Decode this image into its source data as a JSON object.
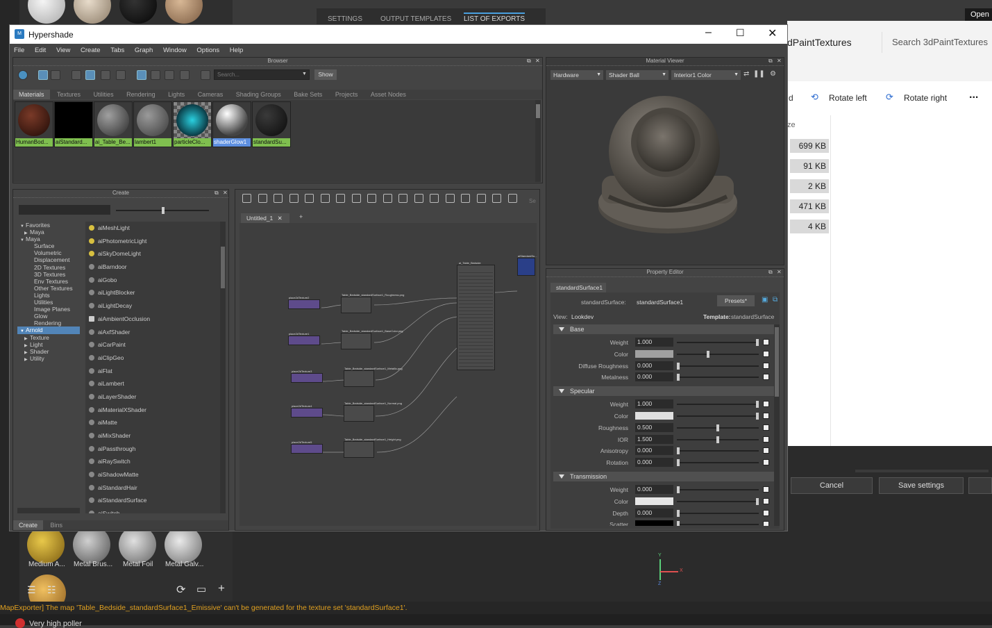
{
  "hypershade": {
    "title": "Hypershade",
    "menu": [
      "File",
      "Edit",
      "View",
      "Create",
      "Tabs",
      "Graph",
      "Window",
      "Options",
      "Help"
    ],
    "browser": {
      "title": "Browser",
      "search_placeholder": "Search...",
      "show_label": "Show",
      "tabs": [
        "Materials",
        "Textures",
        "Utilities",
        "Rendering",
        "Lights",
        "Cameras",
        "Shading Groups",
        "Bake Sets",
        "Projects",
        "Asset Nodes"
      ],
      "materials": [
        {
          "label": "HumanBod...",
          "color": "#3a1a12"
        },
        {
          "label": "aiStandard...",
          "color": "#000000"
        },
        {
          "label": "ai_Table_Be...",
          "color": "#6a6a6a"
        },
        {
          "label": "lambert1",
          "color": "#707070"
        },
        {
          "label": "particleClo...",
          "color": "#1a8a9a"
        },
        {
          "label": "shaderGlow1",
          "color": "#b8b8b8"
        },
        {
          "label": "standardSu...",
          "color": "#1e1e1e"
        }
      ]
    },
    "create": {
      "title": "Create",
      "tree": [
        {
          "label": "Favorites",
          "indent": 0,
          "arrow": "down"
        },
        {
          "label": "Maya",
          "indent": 1,
          "arrow": "right"
        },
        {
          "label": "Maya",
          "indent": 0,
          "arrow": "down"
        },
        {
          "label": "Surface",
          "indent": 2,
          "arrow": ""
        },
        {
          "label": "Volumetric",
          "indent": 2,
          "arrow": ""
        },
        {
          "label": "Displacement",
          "indent": 2,
          "arrow": ""
        },
        {
          "label": "2D Textures",
          "indent": 2,
          "arrow": ""
        },
        {
          "label": "3D Textures",
          "indent": 2,
          "arrow": ""
        },
        {
          "label": "Env Textures",
          "indent": 2,
          "arrow": ""
        },
        {
          "label": "Other Textures",
          "indent": 2,
          "arrow": ""
        },
        {
          "label": "Lights",
          "indent": 2,
          "arrow": ""
        },
        {
          "label": "Utilities",
          "indent": 2,
          "arrow": ""
        },
        {
          "label": "Image Planes",
          "indent": 2,
          "arrow": ""
        },
        {
          "label": "Glow",
          "indent": 2,
          "arrow": ""
        },
        {
          "label": "Rendering",
          "indent": 2,
          "arrow": ""
        },
        {
          "label": "Arnold",
          "indent": 0,
          "arrow": "down",
          "selected": true
        },
        {
          "label": "Texture",
          "indent": 1,
          "arrow": "right"
        },
        {
          "label": "Light",
          "indent": 1,
          "arrow": "right"
        },
        {
          "label": "Shader",
          "indent": 1,
          "arrow": "right"
        },
        {
          "label": "Utility",
          "indent": 1,
          "arrow": "right"
        }
      ],
      "nodes": [
        "aiMeshLight",
        "aiPhotometricLight",
        "aiSkyDomeLight",
        "aiBarndoor",
        "aiGobo",
        "aiLightBlocker",
        "aiLightDecay",
        "aiAmbientOcclusion",
        "aiAxfShader",
        "aiCarPaint",
        "aiClipGeo",
        "aiFlat",
        "aiLambert",
        "aiLayerShader",
        "aiMaterialXShader",
        "aiMatte",
        "aiMixShader",
        "aiPassthrough",
        "aiRaySwitch",
        "aiShadowMatte",
        "aiStandardHair",
        "aiStandardSurface",
        "aiSwitch"
      ],
      "bottom_tabs": [
        "Create",
        "Bins"
      ]
    },
    "graph": {
      "tab_label": "Untitled_1",
      "search_stub": "Se",
      "textures": [
        {
          "file": "place2dTexture2",
          "name": "Table_Bedside_standardSurface1_Roughness.png"
        },
        {
          "file": "place2dTexture1",
          "name": "Table_Bedside_standardSurface1_BaseColor.png"
        },
        {
          "file": "place2dTexture3",
          "name": "Table_Bedside_standardSurface1_Metallic.png"
        },
        {
          "file": "place2dTexture4",
          "name": "Table_Bedside_standardSurface1_Normal.png"
        },
        {
          "file": "place2dTexture5",
          "name": "Table_Bedside_standardSurface1_Height.png"
        }
      ],
      "shader_node": "ai_Table_Bedside",
      "sg_node": "aiStandardSu..."
    },
    "material_viewer": {
      "title": "Material Viewer",
      "renderer": "Hardware",
      "geometry": "Shader Ball",
      "environment": "Interior1 Color"
    },
    "property_editor": {
      "title": "Property Editor",
      "tab": "standardSurface1",
      "type_label": "standardSurface:",
      "node_name": "standardSurface1",
      "presets": "Presets*",
      "view_label": "View:",
      "view_value": "Lookdev",
      "template_label": "Template:",
      "template_value": "standardSurface",
      "sections": [
        {
          "title": "Base",
          "rows": [
            {
              "label": "Weight",
              "value": "1.000",
              "pos": 1.0
            },
            {
              "label": "Color",
              "color": "#a0a0a0",
              "pos": 0.38
            },
            {
              "label": "Diffuse Roughness",
              "value": "0.000",
              "pos": 0.0
            },
            {
              "label": "Metalness",
              "value": "0.000",
              "pos": 0.0
            }
          ]
        },
        {
          "title": "Specular",
          "rows": [
            {
              "label": "Weight",
              "value": "1.000",
              "pos": 1.0
            },
            {
              "label": "Color",
              "color": "#e0e0e0",
              "pos": 1.0
            },
            {
              "label": "Roughness",
              "value": "0.500",
              "pos": 0.5
            },
            {
              "label": "IOR",
              "value": "1.500",
              "pos": 0.5
            },
            {
              "label": "Anisotropy",
              "value": "0.000",
              "pos": 0.0
            },
            {
              "label": "Rotation",
              "value": "0.000",
              "pos": 0.0
            }
          ]
        },
        {
          "title": "Transmission",
          "rows": [
            {
              "label": "Weight",
              "value": "0.000",
              "pos": 0.0
            },
            {
              "label": "Color",
              "color": "#e6e6e6",
              "pos": 1.0
            },
            {
              "label": "Depth",
              "value": "0.000",
              "pos": 0.0
            },
            {
              "label": "Scatter",
              "color": "#000000",
              "pos": 0.0
            }
          ]
        }
      ]
    }
  },
  "background": {
    "top_tabs": [
      "SETTINGS",
      "OUTPUT TEMPLATES",
      "LIST OF EXPORTS"
    ],
    "open_label": "Open",
    "shelf_materials": [
      {
        "label": "Medium A...",
        "color": "#b08a2a"
      },
      {
        "label": "Metal Brus...",
        "color": "#8a8a8a"
      },
      {
        "label": "Metal Foil",
        "color": "#9a9a9a"
      },
      {
        "label": "Metal Galv...",
        "color": "#a8a8a8"
      }
    ],
    "photos": {
      "folder": "dPaintTextures",
      "search": "Search 3dPaintTextures",
      "rotate_left": "Rotate left",
      "rotate_right": "Rotate right",
      "more": "...",
      "col_size_stub": "ze",
      "col_stub": "d",
      "sizes": [
        "699 KB",
        "91 KB",
        "2 KB",
        "471 KB",
        "4 KB"
      ]
    },
    "cancel_label": "Cancel",
    "save_label": "Save settings",
    "status_message": "MapExporter] The map 'Table_Bedside_standardSurface1_Emissive' can't be generated for the texture set 'standardSurface1'.",
    "taskbar_item": "Very high poller",
    "axis_x": "X",
    "axis_y": "Y",
    "axis_z": "Z"
  }
}
